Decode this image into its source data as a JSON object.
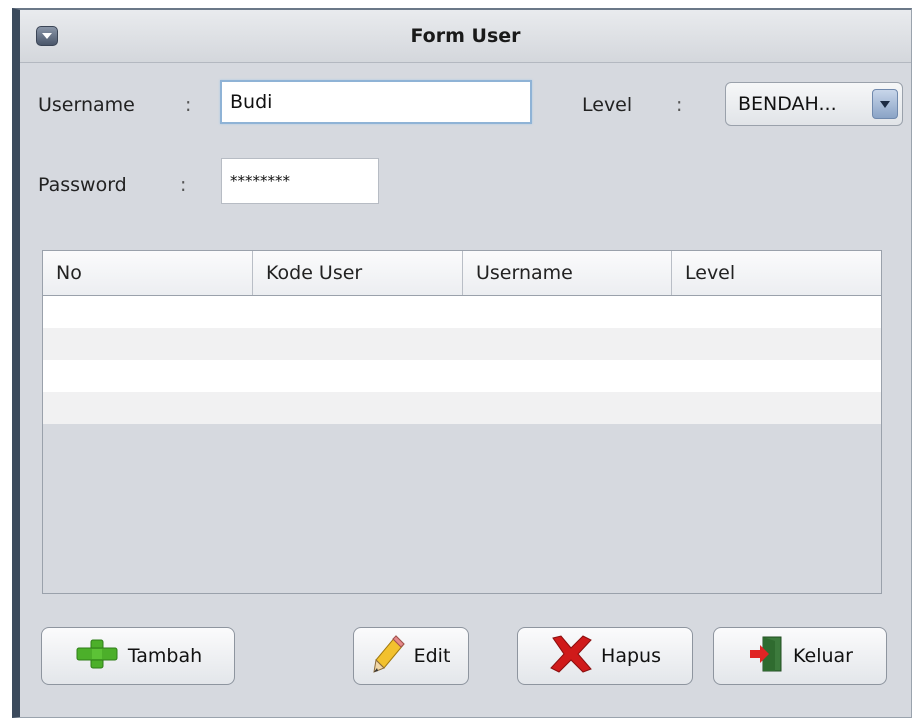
{
  "window": {
    "title": "Form User",
    "menu_icon": "window-menu-icon"
  },
  "form": {
    "username_label": "Username",
    "username_colon": ":",
    "username_value": "Budi",
    "level_label": "Level",
    "level_colon": ":",
    "level_value": "BENDAH...",
    "password_label": "Password",
    "password_colon": ":",
    "password_value": "********"
  },
  "table": {
    "columns": [
      "No",
      "Kode User",
      "Username",
      "Level"
    ],
    "rows": [
      [
        "",
        "",
        "",
        ""
      ],
      [
        "",
        "",
        "",
        ""
      ],
      [
        "",
        "",
        "",
        ""
      ],
      [
        "",
        "",
        "",
        ""
      ]
    ]
  },
  "buttons": {
    "tambah": {
      "label": "Tambah",
      "icon": "plus-icon"
    },
    "edit": {
      "label": "Edit",
      "icon": "pencil-icon"
    },
    "hapus": {
      "label": "Hapus",
      "icon": "x-icon"
    },
    "keluar": {
      "label": "Keluar",
      "icon": "exit-door-icon"
    }
  },
  "colors": {
    "window_border": "#3b4a5c",
    "panel_bg": "#d6d9df",
    "plus_green": "#4caf2a",
    "delete_red": "#d01a1a",
    "pencil_yellow": "#f2c12e"
  }
}
